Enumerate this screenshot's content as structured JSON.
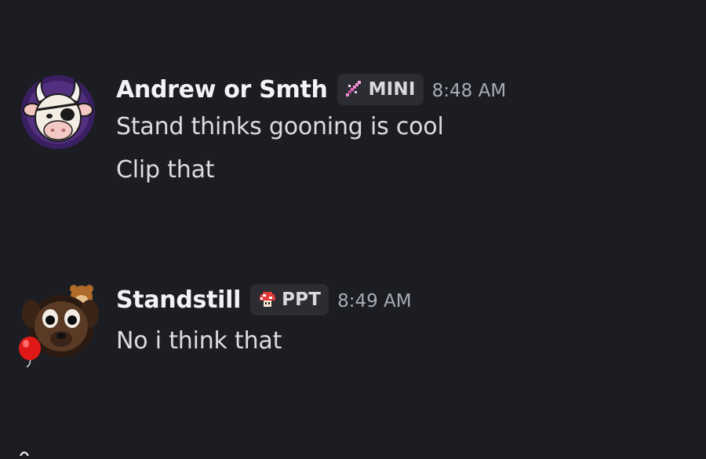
{
  "messages": [
    {
      "username": "Andrew or Smth",
      "role": {
        "label": "MINI",
        "icon": "sword-icon",
        "color": "#f08ad0"
      },
      "timestamp": "8:48 AM",
      "avatar": {
        "description_icon": "cow-pirate-avatar",
        "bg": "#3b1f63"
      },
      "lines": [
        "Stand thinks gooning is cool",
        "Clip that"
      ]
    },
    {
      "username": "Standstill",
      "role": {
        "label": "PPT",
        "icon": "mushroom-icon",
        "color": "#e03a3a"
      },
      "timestamp": "8:49 AM",
      "avatar": {
        "description_icon": "dog-balloon-avatar"
      },
      "lines": [
        "No i think that"
      ]
    }
  ],
  "colors": {
    "background": "#1c1d22",
    "username": "#f2f3f5",
    "message_text": "#dbdde1",
    "timestamp": "#a9abb3",
    "role_tag_bg": "#2b2d33"
  }
}
